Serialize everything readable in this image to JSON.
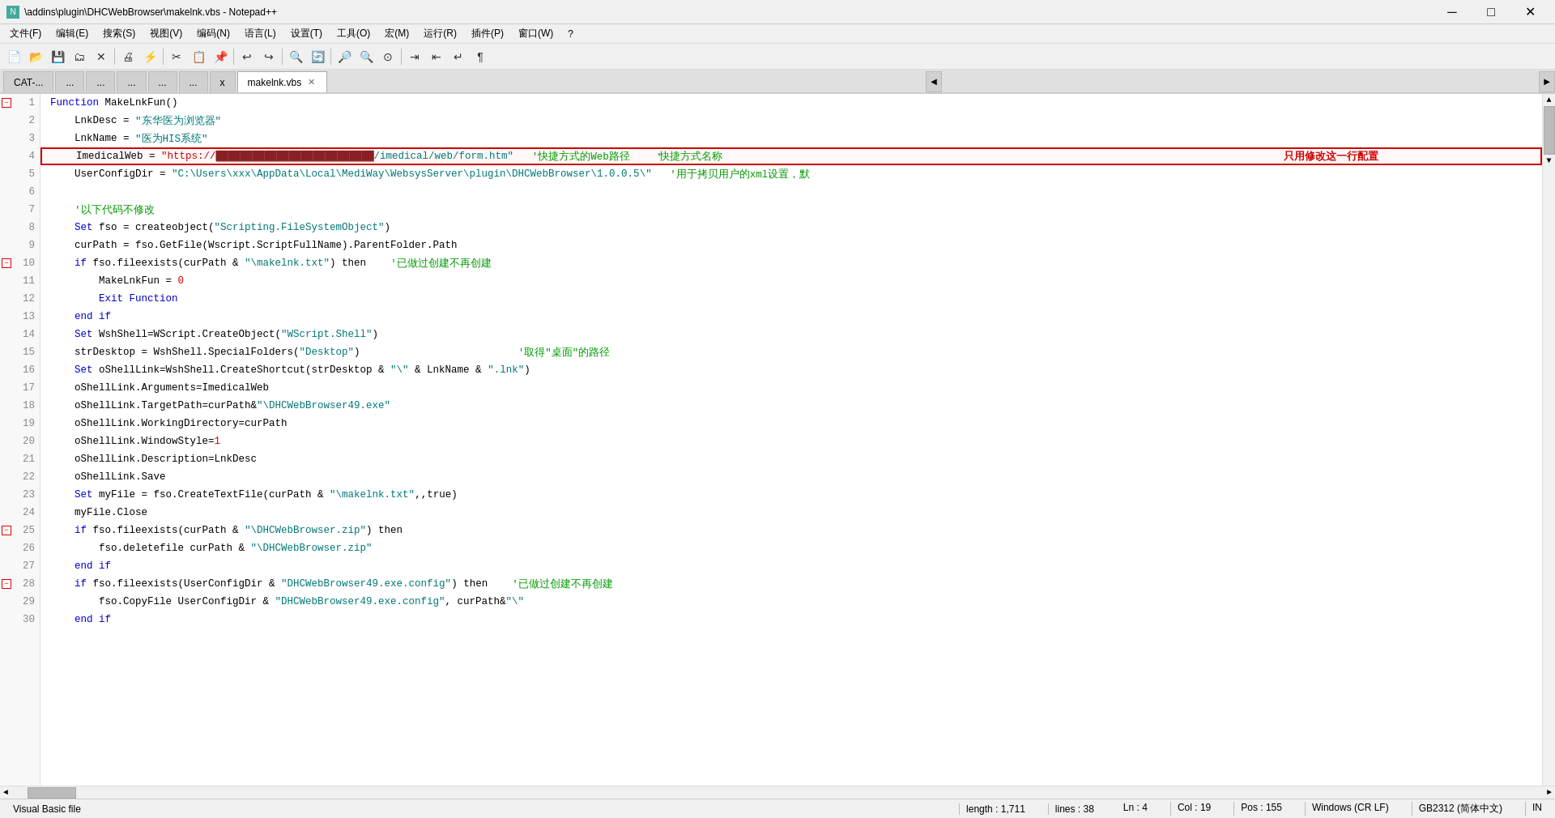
{
  "titleBar": {
    "prefix": "\\addins\\plugin\\DHCWebBrowser\\makelnk.vbs",
    "suffix": " - Notepad++",
    "icon": "N"
  },
  "menuBar": {
    "items": [
      "文件(F)",
      "编辑(E)",
      "搜索(S)",
      "视图(V)",
      "编码(N)",
      "语言(L)",
      "设置(T)",
      "工具(O)",
      "宏(M)",
      "运行(R)",
      "插件(P)",
      "窗口(W)",
      "?"
    ]
  },
  "tabs": [
    {
      "label": "CAT-...",
      "active": false
    },
    {
      "label": "...",
      "active": false
    },
    {
      "label": "...",
      "active": false
    },
    {
      "label": "...",
      "active": false
    },
    {
      "label": "...",
      "active": false
    },
    {
      "label": "...",
      "active": false
    },
    {
      "label": "x",
      "active": false
    },
    {
      "label": "makelnk.vbs",
      "active": true,
      "closable": true
    }
  ],
  "codeLines": [
    {
      "num": 1,
      "fold": "minus",
      "tokens": [
        {
          "t": "Function",
          "c": "kw-blue"
        },
        {
          "t": " MakeLnkFun()",
          "c": "plain"
        }
      ]
    },
    {
      "num": 2,
      "tokens": [
        {
          "t": "    LnkDesc = ",
          "c": "plain"
        },
        {
          "t": "\"东华医为浏览器\"",
          "c": "str-teal"
        }
      ]
    },
    {
      "num": 3,
      "tokens": [
        {
          "t": "    LnkName = ",
          "c": "plain"
        },
        {
          "t": "\"医为HIS系统\"",
          "c": "str-teal"
        }
      ]
    },
    {
      "num": 4,
      "highlighted": true,
      "tokens": [
        {
          "t": "    ImedicalWeb = ",
          "c": "plain"
        },
        {
          "t": "\"https://",
          "c": "str-red"
        },
        {
          "t": "██████████████████████████",
          "c": "str-red",
          "strikethrough": true
        },
        {
          "t": "/imedical/web/form.htm\"",
          "c": "str-teal"
        },
        {
          "t": "   '快捷方式的Web路径",
          "c": "comment-green"
        }
      ],
      "annotation": "'快捷方式名称",
      "annotationRight": "只用修改这一行配置"
    },
    {
      "num": 5,
      "tokens": [
        {
          "t": "    UserConfigDir = ",
          "c": "plain"
        },
        {
          "t": "\"C:\\Users\\xxx\\AppData\\Local\\MediWay\\WebsysServer\\plugin\\DHCWebBrowser\\1.0.0.5\\\"",
          "c": "str-teal"
        },
        {
          "t": "   '用于拷贝用户的xml设置，默",
          "c": "comment-green"
        }
      ]
    },
    {
      "num": 6,
      "tokens": []
    },
    {
      "num": 7,
      "tokens": [
        {
          "t": "    '以下代码不修改",
          "c": "comment-green"
        }
      ]
    },
    {
      "num": 8,
      "tokens": [
        {
          "t": "    ",
          "c": "plain"
        },
        {
          "t": "Set",
          "c": "kw-blue"
        },
        {
          "t": " fso = createobject(",
          "c": "plain"
        },
        {
          "t": "\"Scripting.FileSystemObject\"",
          "c": "str-teal"
        },
        {
          "t": ")",
          "c": "plain"
        }
      ]
    },
    {
      "num": 9,
      "tokens": [
        {
          "t": "    curPath = fso.GetFile(Wscript.ScriptFullName).ParentFolder.Path",
          "c": "plain"
        }
      ]
    },
    {
      "num": 10,
      "fold": "minus",
      "tokens": [
        {
          "t": "    ",
          "c": "plain"
        },
        {
          "t": "if",
          "c": "kw-blue"
        },
        {
          "t": " fso.fileexists(curPath & ",
          "c": "plain"
        },
        {
          "t": "\"\\makelnk.txt\"",
          "c": "str-teal"
        },
        {
          "t": ") then",
          "c": "plain"
        },
        {
          "t": "    '已做过创建不再创建",
          "c": "comment-green"
        }
      ]
    },
    {
      "num": 11,
      "tokens": [
        {
          "t": "        MakeLnkFun = ",
          "c": "plain"
        },
        {
          "t": "0",
          "c": "num-red"
        }
      ]
    },
    {
      "num": 12,
      "tokens": [
        {
          "t": "        ",
          "c": "plain"
        },
        {
          "t": "Exit",
          "c": "kw-blue"
        },
        {
          "t": " ",
          "c": "plain"
        },
        {
          "t": "Function",
          "c": "kw-blue"
        }
      ]
    },
    {
      "num": 13,
      "tokens": [
        {
          "t": "    ",
          "c": "plain"
        },
        {
          "t": "end if",
          "c": "kw-blue"
        }
      ]
    },
    {
      "num": 14,
      "tokens": [
        {
          "t": "    ",
          "c": "plain"
        },
        {
          "t": "Set",
          "c": "kw-blue"
        },
        {
          "t": " WshShell=WScript.CreateObject(",
          "c": "plain"
        },
        {
          "t": "\"WScript.Shell\"",
          "c": "str-teal"
        },
        {
          "t": ")",
          "c": "plain"
        }
      ]
    },
    {
      "num": 15,
      "tokens": [
        {
          "t": "    strDesktop = WshShell.SpecialFolders(",
          "c": "plain"
        },
        {
          "t": "\"Desktop\"",
          "c": "str-teal"
        },
        {
          "t": ")",
          "c": "plain"
        },
        {
          "t": "                          '取得\"桌面\"的路径",
          "c": "comment-green"
        }
      ]
    },
    {
      "num": 16,
      "tokens": [
        {
          "t": "    ",
          "c": "plain"
        },
        {
          "t": "Set",
          "c": "kw-blue"
        },
        {
          "t": " oShellLink=WshShell.CreateShortcut(strDesktop & ",
          "c": "plain"
        },
        {
          "t": "\"\\\"",
          "c": "str-teal"
        },
        {
          "t": " & LnkName & ",
          "c": "plain"
        },
        {
          "t": "\".lnk\"",
          "c": "str-teal"
        },
        {
          "t": ")",
          "c": "plain"
        }
      ]
    },
    {
      "num": 17,
      "tokens": [
        {
          "t": "    oShellLink.Arguments=ImedicalWeb",
          "c": "plain"
        }
      ]
    },
    {
      "num": 18,
      "tokens": [
        {
          "t": "    oShellLink.TargetPath=curPath&",
          "c": "plain"
        },
        {
          "t": "\"\\DHCWebBrowser49.exe\"",
          "c": "str-teal"
        }
      ]
    },
    {
      "num": 19,
      "tokens": [
        {
          "t": "    oShellLink.WorkingDirectory=curPath",
          "c": "plain"
        }
      ]
    },
    {
      "num": 20,
      "tokens": [
        {
          "t": "    oShellLink.WindowStyle=",
          "c": "plain"
        },
        {
          "t": "1",
          "c": "num-red"
        }
      ]
    },
    {
      "num": 21,
      "tokens": [
        {
          "t": "    oShellLink.Description=LnkDesc",
          "c": "plain"
        }
      ]
    },
    {
      "num": 22,
      "tokens": [
        {
          "t": "    oShellLink.Save",
          "c": "plain"
        }
      ]
    },
    {
      "num": 23,
      "tokens": [
        {
          "t": "    ",
          "c": "plain"
        },
        {
          "t": "Set",
          "c": "kw-blue"
        },
        {
          "t": " myFile = fso.CreateTextFile(curPath & ",
          "c": "plain"
        },
        {
          "t": "\"\\makelnk.txt\"",
          "c": "str-teal"
        },
        {
          "t": ",,true)",
          "c": "plain"
        }
      ]
    },
    {
      "num": 24,
      "tokens": [
        {
          "t": "    myFile.Close",
          "c": "plain"
        }
      ]
    },
    {
      "num": 25,
      "fold": "minus",
      "tokens": [
        {
          "t": "    ",
          "c": "plain"
        },
        {
          "t": "if",
          "c": "kw-blue"
        },
        {
          "t": " fso.fileexists(curPath & ",
          "c": "plain"
        },
        {
          "t": "\"\\DHCWebBrowser.zip\"",
          "c": "str-teal"
        },
        {
          "t": ") then",
          "c": "plain"
        }
      ]
    },
    {
      "num": 26,
      "tokens": [
        {
          "t": "        fso.deletefile curPath & ",
          "c": "plain"
        },
        {
          "t": "\"\\DHCWebBrowser.zip\"",
          "c": "str-teal"
        }
      ]
    },
    {
      "num": 27,
      "tokens": [
        {
          "t": "    ",
          "c": "plain"
        },
        {
          "t": "end if",
          "c": "kw-blue"
        }
      ]
    },
    {
      "num": 28,
      "fold": "minus",
      "tokens": [
        {
          "t": "    ",
          "c": "plain"
        },
        {
          "t": "if",
          "c": "kw-blue"
        },
        {
          "t": " fso.fileexists(UserConfigDir & ",
          "c": "plain"
        },
        {
          "t": "\"DHCWebBrowser49.exe.config\"",
          "c": "str-teal"
        },
        {
          "t": ") then",
          "c": "plain"
        },
        {
          "t": "    '已做过创建不再创建",
          "c": "comment-green"
        }
      ]
    },
    {
      "num": 29,
      "tokens": [
        {
          "t": "        fso.CopyFile UserConfigDir & ",
          "c": "plain"
        },
        {
          "t": "\"DHCWebBrowser49.exe.config\"",
          "c": "str-teal"
        },
        {
          "t": ", curPath&",
          "c": "plain"
        },
        {
          "t": "\"\\\"",
          "c": "str-teal"
        }
      ]
    },
    {
      "num": 30,
      "tokens": [
        {
          "t": "    ",
          "c": "plain"
        },
        {
          "t": "end if",
          "c": "kw-blue"
        }
      ]
    }
  ],
  "statusBar": {
    "fileType": "Visual Basic file",
    "length": "length : 1,711",
    "lines": "lines : 38",
    "ln": "Ln : 4",
    "col": "Col : 19",
    "pos": "Pos : 155",
    "lineEnding": "Windows (CR LF)",
    "encoding": "GB2312 (简体中文)",
    "ins": "IN"
  }
}
